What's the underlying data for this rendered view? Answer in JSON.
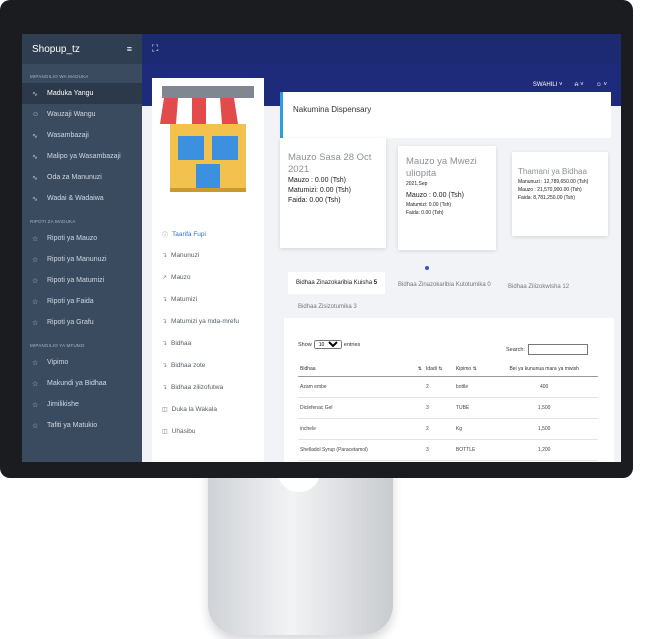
{
  "app": {
    "brand": "Shopup_tz"
  },
  "sidebar": {
    "sections": [
      {
        "title": "MIPANGILIO WA MADUKA",
        "items": [
          "Maduka Yangu",
          "Wauzaji Wangu",
          "Wasambazaji",
          "Malipo ya Wasambazaji",
          "Oda za Manunuzi",
          "Wadai & Wadaiwa"
        ]
      },
      {
        "title": "RIPOTI ZA MADUKA",
        "items": [
          "Ripoti ya Mauzo",
          "Ripoti ya Manunuzi",
          "Ripoti ya Matumizi",
          "Ripoti ya Faida",
          "Ripoti ya Grafu"
        ]
      },
      {
        "title": "MIPANGILIO YA MFUMO",
        "items": [
          "Vipimo",
          "Makundi ya Bidhaa",
          "Jimilikishe",
          "Tafiti ya Matukio"
        ]
      }
    ]
  },
  "navbar": {
    "language": "SWAHILI",
    "bell": "⍾",
    "user": "☺"
  },
  "left_panel": {
    "items": [
      "Taarifa Fupi",
      "Manunuzi",
      "Mauzo",
      "Matumizi",
      "Matumizi ya mda-mrefu",
      "Bidhaa",
      "Bidhaa zote",
      "Bidhaa zilizofutwa",
      "Duka la Wakala",
      "Uhasibu"
    ]
  },
  "shop": {
    "title": "Nakumina Dispensary"
  },
  "cards": {
    "today": {
      "title": "Mauzo Sasa 28 Oct 2021",
      "sales": "Mauzo : 0.00 (Tsh)",
      "expenses": "Matumizi: 0.00 (Tsh)",
      "profit": "Faida: 0.00 (Tsh)"
    },
    "month": {
      "title": "Mauzo ya Mwezi uliopita",
      "period": "2021,Sep",
      "sales": "Mauzo : 0.00 (Tsh)",
      "expenses": "Matumizi: 0.00 (Tsh)",
      "profit": "Faida: 0.00 (Tsh)"
    },
    "stock": {
      "title": "Thamani ya Bidhaa",
      "purchases": "Manunuzi : 12,789,650.00 (Tsh)",
      "sales": "Mauzo : 21,570,900.00 (Tsh)",
      "profit": "Faida: 8,781,250.00 (Tsh)"
    }
  },
  "tabs": [
    {
      "label": "Bidhaa Zinazokaribia Kuisha",
      "count": "5"
    },
    {
      "label": "Bidhaa Zinazokaribia Kutotumika",
      "count": "0"
    },
    {
      "label": "Bidhaa Zilizokwisha",
      "count": "12"
    },
    {
      "label": "Bidhaa Zisizotumika",
      "count": "3"
    }
  ],
  "datatable": {
    "show_label": "Show",
    "entries_value": "10",
    "entries_label": "entries",
    "search_label": "Search:",
    "columns": [
      "Bidhaa",
      "Idadi",
      "Kipimo",
      "Bei ya kununua mara ya mwish"
    ],
    "rows": [
      [
        "Azam embe",
        "2",
        "bottle",
        "400"
      ],
      [
        "Diclefenac Gel",
        "3",
        "TUBE",
        "1,500"
      ],
      [
        "inchele",
        "2",
        "Kg",
        "1,500"
      ],
      [
        "Shelladol Syrup (Paracetamol)",
        "3",
        "BOTTLE",
        "1,200"
      ]
    ]
  },
  "colors": {
    "sidebar": "#3a4b60",
    "topbar": "#1e2a7a",
    "accent": "#2f6fd6"
  }
}
